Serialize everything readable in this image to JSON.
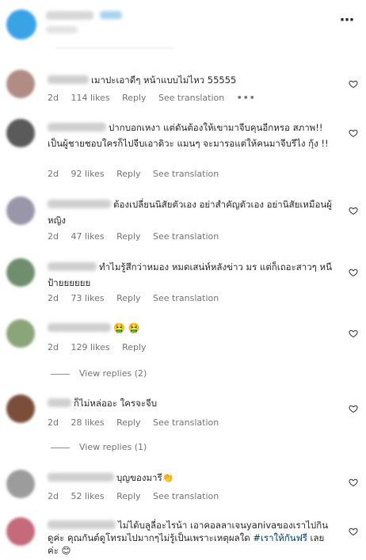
{
  "header": {
    "more_icon": "⋯"
  },
  "labels": {
    "reply": "Reply",
    "see_translation": "See translation",
    "more_dots": "•••"
  },
  "comments": [
    {
      "text": "เมาปะเอาดีๆ หน้าแบบไม่ไหว 55555",
      "time": "2d",
      "likes": "114 likes",
      "avatar_color": "#b08c84"
    },
    {
      "text": "ปากบอกเหงา แต่ดันต้องให้เขามาจีบคุนอีกหรอ สภาพ!! เป็นผู้ชายชอบใครก็ไปจีบเอาดิวะ แมนๆ จะมารอแต่ให้คนมาจีบรึไง กุ้ง !!",
      "time": "2d",
      "likes": "92 likes",
      "avatar_color": "#5a5a5a"
    },
    {
      "text": "ต้องเปลี่ยนนิสัยตัวเอง อย่าสำคัญตัวเอง อย่านิสัยเหมือนผู้หญิง",
      "time": "2d",
      "likes": "47 likes",
      "avatar_color": "#9a96aa"
    },
    {
      "text": "ทำไมรู้สึกว่าหมอง หมดเสน่ห์หลังข่าว มร แต่ก็เถอะสาวๆ หนีป้ายยยยยย",
      "time": "2d",
      "likes": "73 likes",
      "avatar_color": "#6e8e6e"
    },
    {
      "text": "🤮 🤮",
      "time": "2d",
      "likes": "129 likes",
      "avatar_color": "#8aa57a",
      "view_replies": "View replies (2)"
    },
    {
      "text": "ก็ไม่หล่ออะ ใครจะจีบ",
      "time": "2d",
      "likes": "28 likes",
      "avatar_color": "#7a4e3a",
      "view_replies": "View replies (1)"
    },
    {
      "text": "บุญของมารี👏",
      "time": "2d",
      "likes": "52 likes",
      "avatar_color": "#9c9c9c"
    },
    {
      "text_main": "ไม่ได้บลูลี่อะไรน้า เอาคอลลาเจนyanivaของเราไปกินดูค่ะ คุณกันต์ดูโทรมไปมากๆไม่รู้เป็นเพราะเหตุผลใด ",
      "hashtag": "#เราให้กันฟรี",
      "text_end": " เลยค่ะ 😊",
      "avatar_color": "#c46a7a"
    }
  ]
}
